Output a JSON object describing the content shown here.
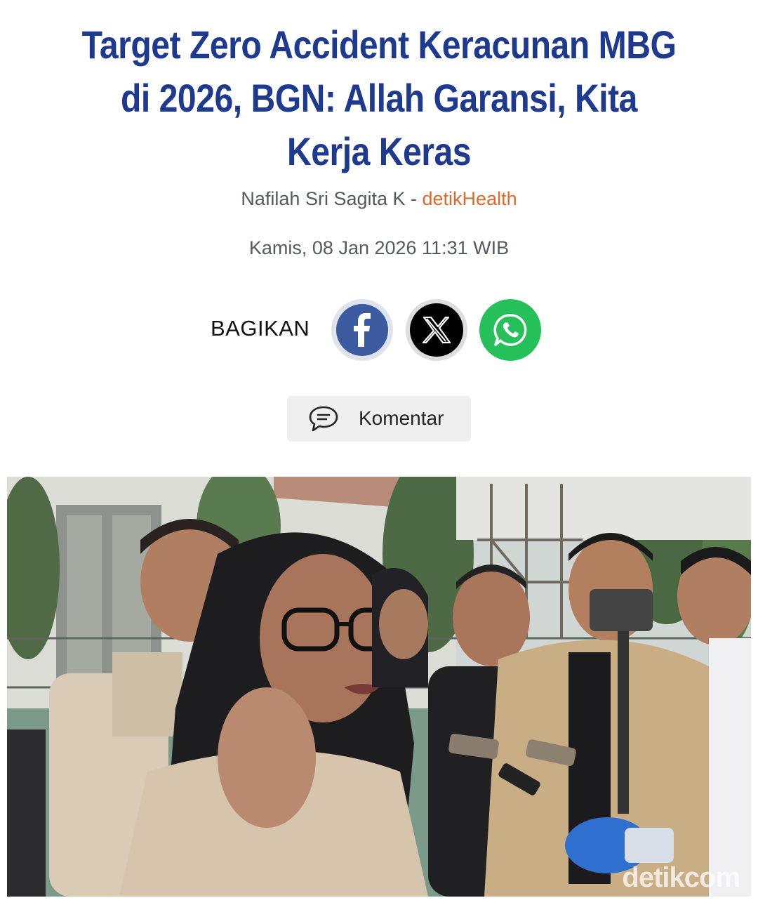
{
  "article": {
    "headline": "Target Zero Accident Keracunan MBG di 2026, BGN: Allah Garansi, Kita Kerja Keras",
    "author": "Nafilah Sri Sagita K",
    "separator": " - ",
    "source": "detikHealth",
    "date": "Kamis, 08 Jan 2026 11:31 WIB"
  },
  "share": {
    "label": "BAGIKAN",
    "buttons": [
      {
        "name": "facebook",
        "icon": "facebook-icon",
        "color": "#3b5aa0"
      },
      {
        "name": "x",
        "icon": "x-icon",
        "color": "#000000"
      },
      {
        "name": "whatsapp",
        "icon": "whatsapp-icon",
        "color": "#25c05a"
      }
    ]
  },
  "comment": {
    "label": "Komentar",
    "icon": "comment-bubble-icon"
  },
  "photo": {
    "watermark": "detikcom"
  },
  "colors": {
    "headline": "#1e3a8f",
    "source": "#e0692a",
    "meta": "#555a60"
  }
}
